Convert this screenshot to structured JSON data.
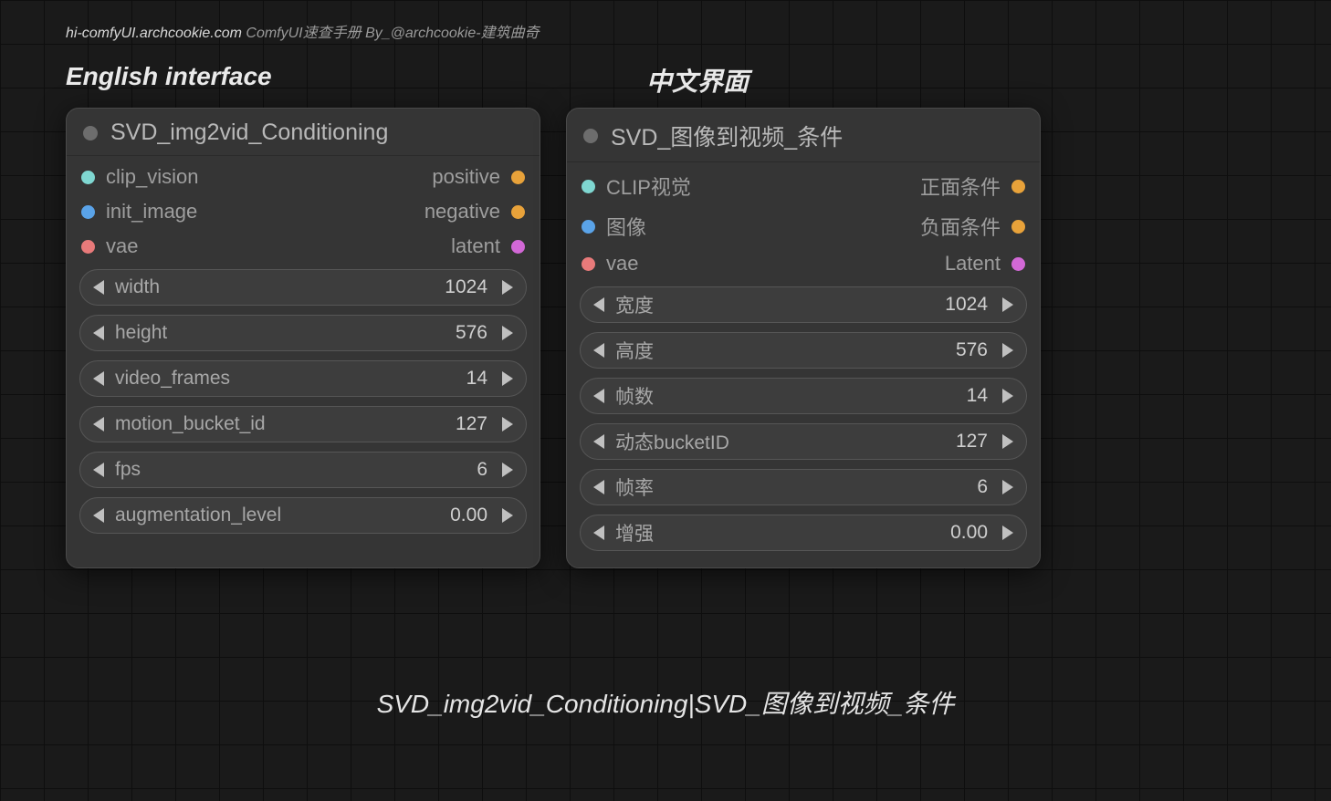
{
  "topbar": {
    "site": "hi-comfyUI.archcookie.com",
    "tagline": " ComfyUI速查手册 By_@archcookie-建筑曲奇"
  },
  "labels": {
    "english": "English interface",
    "chinese": "中文界面"
  },
  "caption": "SVD_img2vid_Conditioning|SVD_图像到视频_条件",
  "colors": {
    "clip_vision": "#7fd7d1",
    "init_image": "#5aa3e8",
    "vae": "#e87a7a",
    "positive": "#e8a23a",
    "negative": "#e8a23a",
    "latent": "#d268d6"
  },
  "nodes": [
    {
      "title": "SVD_img2vid_Conditioning",
      "inputs": [
        {
          "name": "clip_vision",
          "colorKey": "clip_vision"
        },
        {
          "name": "init_image",
          "colorKey": "init_image"
        },
        {
          "name": "vae",
          "colorKey": "vae"
        }
      ],
      "outputs": [
        {
          "name": "positive",
          "colorKey": "positive"
        },
        {
          "name": "negative",
          "colorKey": "negative"
        },
        {
          "name": "latent",
          "colorKey": "latent"
        }
      ],
      "params": [
        {
          "label": "width",
          "value": "1024"
        },
        {
          "label": "height",
          "value": "576"
        },
        {
          "label": "video_frames",
          "value": "14"
        },
        {
          "label": "motion_bucket_id",
          "value": "127"
        },
        {
          "label": "fps",
          "value": "6"
        },
        {
          "label": "augmentation_level",
          "value": "0.00"
        }
      ]
    },
    {
      "title": "SVD_图像到视频_条件",
      "inputs": [
        {
          "name": "CLIP视觉",
          "colorKey": "clip_vision"
        },
        {
          "name": "图像",
          "colorKey": "init_image"
        },
        {
          "name": "vae",
          "colorKey": "vae"
        }
      ],
      "outputs": [
        {
          "name": "正面条件",
          "colorKey": "positive"
        },
        {
          "name": "负面条件",
          "colorKey": "negative"
        },
        {
          "name": "Latent",
          "colorKey": "latent"
        }
      ],
      "params": [
        {
          "label": "宽度",
          "value": "1024"
        },
        {
          "label": "高度",
          "value": "576"
        },
        {
          "label": "帧数",
          "value": "14"
        },
        {
          "label": "动态bucketID",
          "value": "127"
        },
        {
          "label": "帧率",
          "value": "6"
        },
        {
          "label": "增强",
          "value": "0.00"
        }
      ]
    }
  ]
}
